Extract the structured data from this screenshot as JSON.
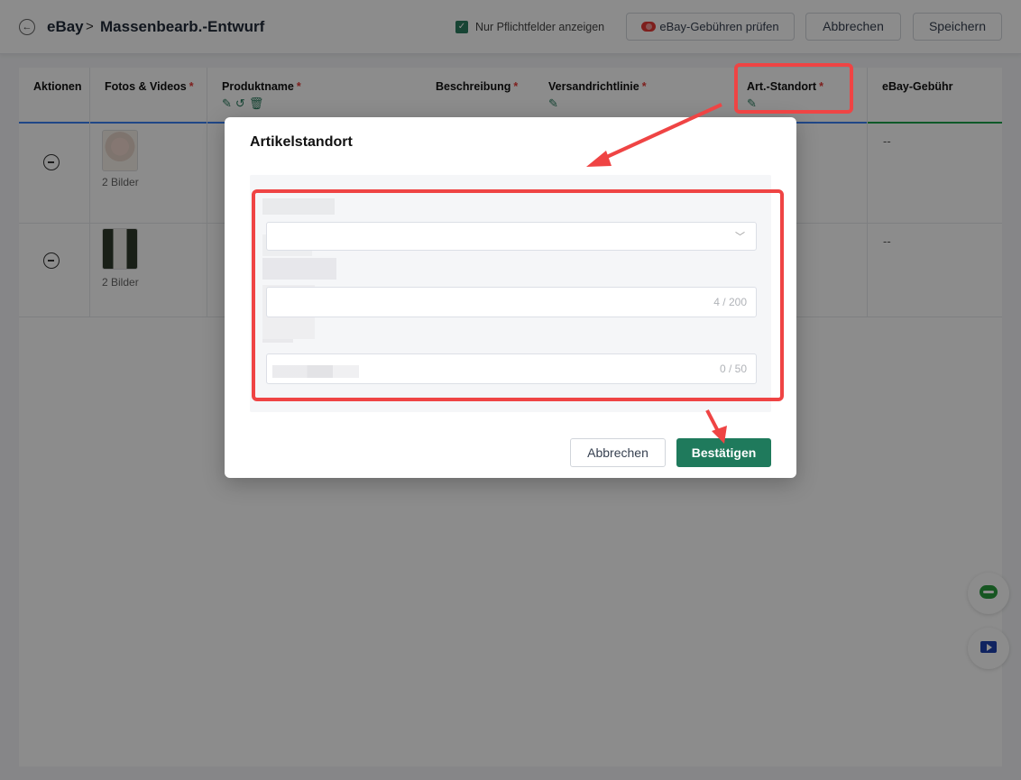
{
  "header": {
    "root": "eBay",
    "separator": ">",
    "title": "Massenbearb.-Entwurf",
    "required_only_label": "Nur Pflichtfelder anzeigen",
    "required_only_checked": true,
    "fee_check_label": "eBay-Gebühren prüfen",
    "cancel_label": "Abbrechen",
    "save_label": "Speichern"
  },
  "table": {
    "columns": [
      {
        "label": "Aktionen",
        "required": false
      },
      {
        "label": "Fotos & Videos",
        "required": true
      },
      {
        "label": "Produktname",
        "required": true
      },
      {
        "label": "Beschreibung",
        "required": true
      },
      {
        "label": "Versandrichtlinie",
        "required": true
      },
      {
        "label": "Art.-Standort",
        "required": true
      },
      {
        "label": "eBay-Gebühr",
        "required": false
      }
    ],
    "rows": [
      {
        "pictures": "2 Bilder",
        "fee": "--"
      },
      {
        "pictures": "2 Bilder",
        "fee": "--"
      }
    ]
  },
  "modal": {
    "title": "Artikelstandort",
    "fields": [
      {
        "type": "select",
        "value": ""
      },
      {
        "type": "text",
        "counter": "4 / 200"
      },
      {
        "type": "text",
        "counter": "0 / 50"
      }
    ],
    "cancel_label": "Abbrechen",
    "confirm_label": "Bestätigen"
  },
  "colors": {
    "accent": "#1f7a5c",
    "annotation": "#ef4444",
    "required_star": "#e53935"
  },
  "icons": [
    "back-arrow-icon",
    "checkbox-icon",
    "fee-icon",
    "edit-icon",
    "undo-icon",
    "trash-icon",
    "minus-circle-icon",
    "chevron-down-icon",
    "chat-icon",
    "video-icon"
  ]
}
